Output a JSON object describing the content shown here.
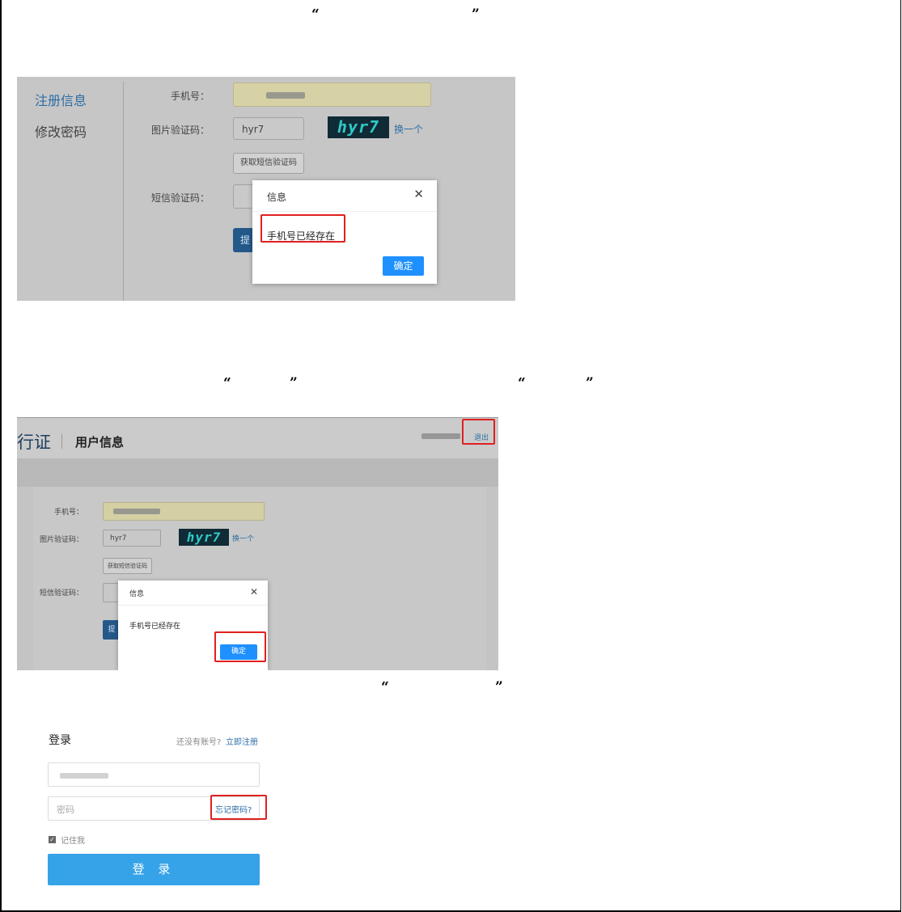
{
  "quotes": {
    "q1_open": "“",
    "q1_close": "”",
    "q2_open": "“",
    "q2_close": "”",
    "q3_open": "“",
    "q3_close": "”",
    "q4_open": "“",
    "q4_close": "”"
  },
  "shot1": {
    "nav": [
      "注册信息",
      "修改密码"
    ],
    "labels": {
      "phone": "手机号：",
      "captcha": "图片验证码：",
      "sms": "短信验证码："
    },
    "captcha_value": "hyr7",
    "captcha_image_text": "hyr7",
    "swap_link": "换一个",
    "get_sms_button": "获取短信验证码",
    "submit_partial": "提",
    "dialog": {
      "title": "信息",
      "close": "✕",
      "message": "手机号已经存在",
      "ok": "确定"
    }
  },
  "shot2": {
    "brand_partial": "行证",
    "page_title": "用户信息",
    "logout": "退出",
    "labels": {
      "phone": "手机号：",
      "captcha": "图片验证码：",
      "sms": "短信验证码："
    },
    "captcha_value": "hyr7",
    "captcha_image_text": "hyr7",
    "swap_link": "换一个",
    "get_sms_button": "获取短信验证码",
    "submit_partial": "提",
    "dialog": {
      "title": "信息",
      "close": "✕",
      "message": "手机号已经存在",
      "ok": "确定"
    }
  },
  "shot3": {
    "title": "登录",
    "no_account": "还没有账号?",
    "register_link": "立即注册",
    "password_placeholder": "密码",
    "forgot_link": "忘记密码?",
    "remember_me": "记住我",
    "remember_checked": true,
    "login_button": "登 录"
  },
  "colors": {
    "accent": "#1e90ff",
    "highlight": "#e02020",
    "link": "#2d6ea6"
  }
}
